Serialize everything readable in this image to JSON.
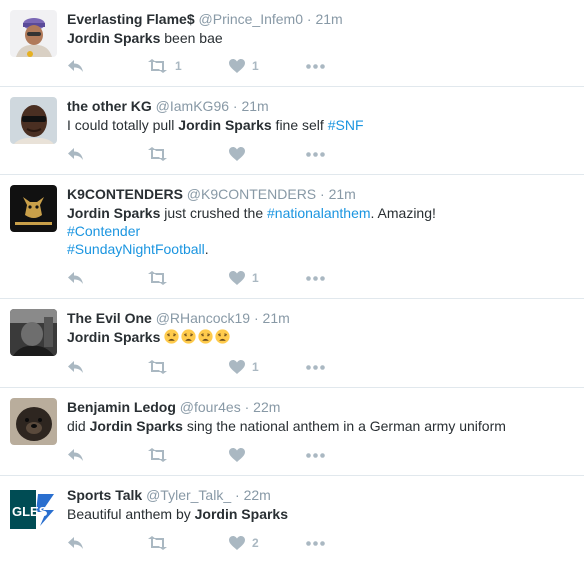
{
  "colors": {
    "hashtag": "#1b95e0",
    "muted": "#8899a6",
    "icon": "#aab8c2",
    "divider": "#e1e8ed"
  },
  "tweets": [
    {
      "fullname": "Everlasting Flame$",
      "username": "@Prince_Infem0",
      "sep": "·",
      "time": "21m",
      "text": [
        {
          "t": "Jordin Sparks",
          "bold": true
        },
        {
          "t": " been bae"
        }
      ],
      "retweets": "1",
      "likes": "1",
      "avatar": "avatar-man-purple-cap"
    },
    {
      "fullname": "the other KG",
      "username": "@IamKG96",
      "sep": "·",
      "time": "21m",
      "text": [
        {
          "t": "I could totally pull "
        },
        {
          "t": "Jordin Sparks",
          "bold": true
        },
        {
          "t": " fine self "
        },
        {
          "t": "#SNF",
          "hashtag": true
        }
      ],
      "retweets": "",
      "likes": "",
      "avatar": "avatar-man-sunglasses"
    },
    {
      "fullname": "K9CONTENDERS",
      "username": "@K9CONTENDERS",
      "sep": "·",
      "time": "21m",
      "text": [
        {
          "t": "Jordin Sparks",
          "bold": true
        },
        {
          "t": " just crushed the "
        },
        {
          "t": "#nationalanthem",
          "hashtag": true
        },
        {
          "t": ". Amazing!"
        },
        {
          "br": true
        },
        {
          "t": "#Contender",
          "hashtag": true
        },
        {
          "br": true
        },
        {
          "t": "#SundayNightFootball",
          "hashtag": true
        },
        {
          "t": "."
        }
      ],
      "retweets": "",
      "likes": "1",
      "avatar": "avatar-k9-dog-logo"
    },
    {
      "fullname": "The Evil One",
      "username": "@RHancock19",
      "sep": "·",
      "time": "21m",
      "text": [
        {
          "t": "Jordin Sparks",
          "bold": true
        },
        {
          "t": " "
        },
        {
          "emoji": 4
        }
      ],
      "retweets": "",
      "likes": "1",
      "avatar": "avatar-bw-photo"
    },
    {
      "fullname": "Benjamin Ledog",
      "username": "@four4es",
      "sep": "·",
      "time": "22m",
      "text": [
        {
          "t": "did "
        },
        {
          "t": "Jordin Sparks",
          "bold": true
        },
        {
          "t": " sing the national anthem in a German army uniform"
        }
      ],
      "retweets": "",
      "likes": "",
      "avatar": "avatar-dog-photo"
    },
    {
      "fullname": "Sports Talk",
      "username": "@Tyler_Talk_",
      "sep": "·",
      "time": "22m",
      "text": [
        {
          "t": "Beautiful anthem by "
        },
        {
          "t": "Jordin Sparks",
          "bold": true
        }
      ],
      "retweets": "",
      "likes": "2",
      "avatar": "avatar-eagles-logo",
      "avatar_text": "GLES"
    }
  ]
}
